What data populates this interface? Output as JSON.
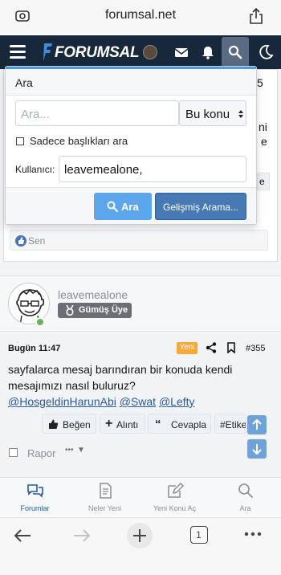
{
  "browser": {
    "host": "forumsal.net",
    "tab_count": "1"
  },
  "site": {
    "logo_text": "FORUMSAL",
    "accent": "#4b9be3",
    "header_bg": "#18283b"
  },
  "search_popup": {
    "title": "Ara",
    "query_placeholder": "Ara...",
    "scope_value": "Bu konu",
    "titles_only_label": "Sadece başlıkları ara",
    "user_label": "Kullanıcı:",
    "user_value": "leavemealone,",
    "search_button": "Ara",
    "advanced_button": "Gelişmiş Arama..."
  },
  "behind": {
    "partial_digit": "5",
    "partial_i": "ni",
    "partial_e": "e",
    "partial_e2": "e",
    "reaction": "Sen"
  },
  "post": {
    "username": "leavemealone",
    "badge": "Gümüş Üye",
    "date": "Bugün 11:47",
    "new_label": "Yeni",
    "number": "#355",
    "text": "sayfalarca mesaj barındıran bir konuda kendi mesajımızı nasıl buluruz?",
    "mentions": [
      "@HosgeldinHarunAbi",
      "@Swat",
      "@Lefty"
    ],
    "actions": {
      "like": "Beğen",
      "quote": "Alıntı",
      "reply": "Cevapla",
      "tag": "#Etike"
    },
    "report": "Rapor",
    "more": "•••"
  },
  "forum_tabs": [
    {
      "label": "Forumlar",
      "icon": "chat-bubbles-icon",
      "active": true
    },
    {
      "label": "Neler Yeni",
      "icon": "document-icon",
      "active": false
    },
    {
      "label": "Yeni Konu Aç",
      "icon": "edit-icon",
      "active": false
    },
    {
      "label": "Ara",
      "icon": "search-icon",
      "active": false
    }
  ]
}
